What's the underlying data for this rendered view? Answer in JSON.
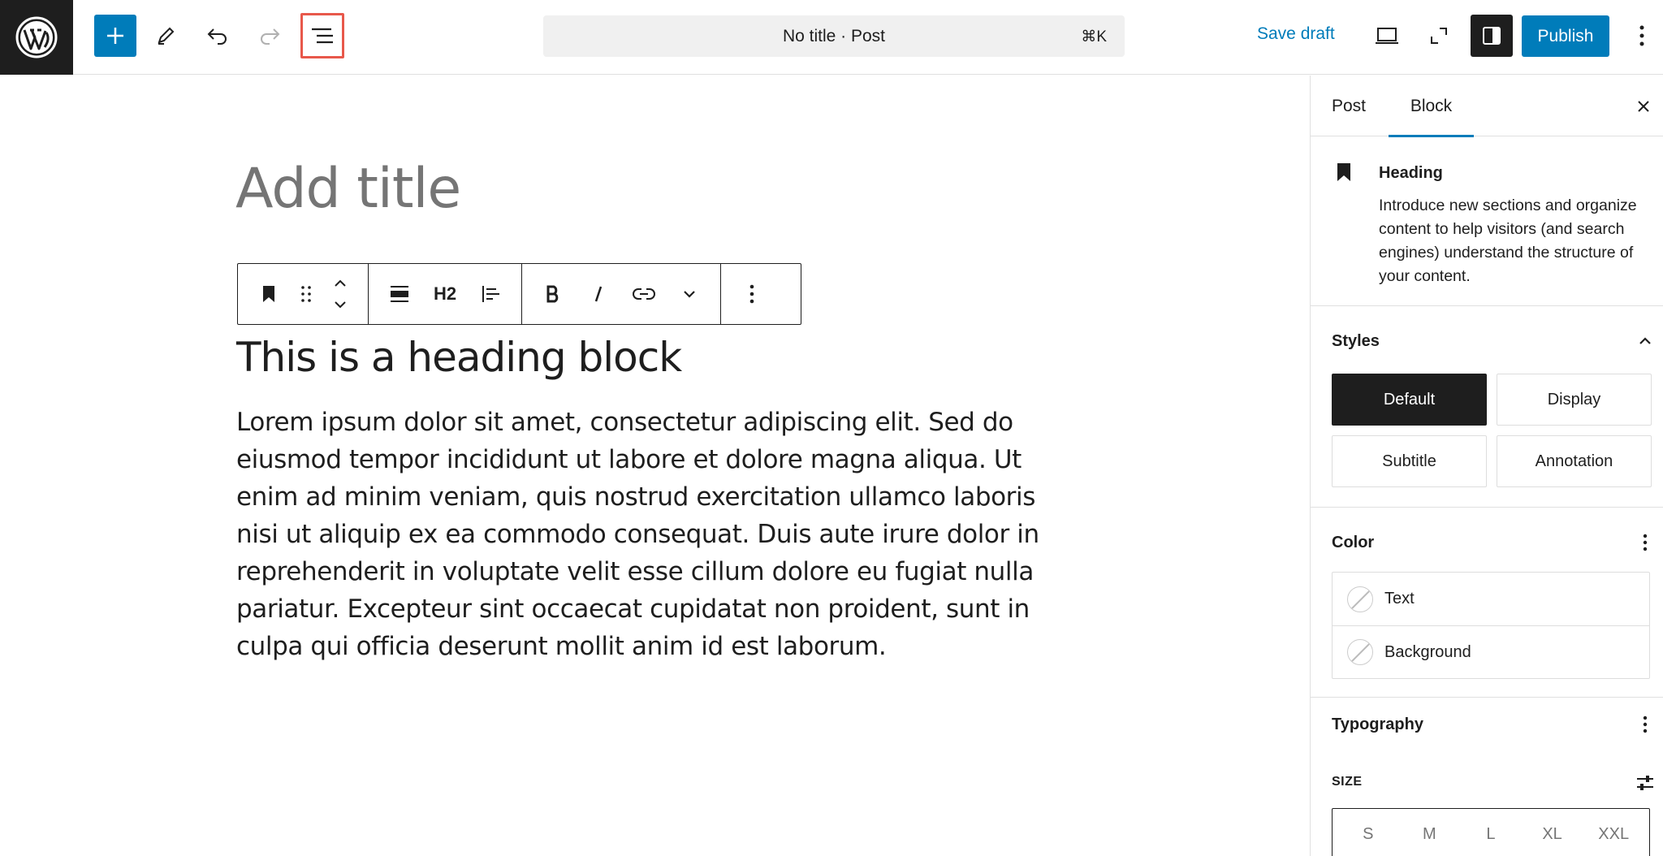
{
  "topbar": {
    "document_title": "No title · Post",
    "command_shortcut": "⌘K",
    "save_draft_label": "Save draft",
    "publish_label": "Publish",
    "icons": [
      "wordpress-logo",
      "plus-icon",
      "pencil-icon",
      "undo-icon",
      "redo-icon",
      "list-view-icon",
      "desktop-preview-icon",
      "fullscreen-icon",
      "sidebar-toggle-icon",
      "more-vertical-icon"
    ]
  },
  "editor": {
    "title_placeholder": "Add title",
    "toolbar": {
      "heading_level_label": "H2"
    },
    "heading_text": "This is a heading block",
    "paragraph_text": "Lorem ipsum dolor sit amet, consectetur adipiscing elit. Sed do eiusmod tempor incididunt ut labore et dolore magna aliqua. Ut enim ad minim veniam, quis nostrud exercitation ullamco laboris nisi ut aliquip ex ea commodo consequat. Duis aute irure dolor in reprehenderit in voluptate velit esse cillum dolore eu fugiat nulla pariatur. Excepteur sint occaecat cupidatat non proident, sunt in culpa qui officia deserunt mollit anim id est laborum."
  },
  "sidebar": {
    "tabs": [
      {
        "label": "Post",
        "active": false
      },
      {
        "label": "Block",
        "active": true
      }
    ],
    "block_card": {
      "name": "Heading",
      "description": "Introduce new sections and organize content to help visitors (and search engines) understand the structure of your content."
    },
    "styles": {
      "title": "Styles",
      "options": [
        {
          "label": "Default",
          "active": true
        },
        {
          "label": "Display",
          "active": false
        },
        {
          "label": "Subtitle",
          "active": false
        },
        {
          "label": "Annotation",
          "active": false
        }
      ]
    },
    "color": {
      "title": "Color",
      "items": [
        {
          "label": "Text"
        },
        {
          "label": "Background"
        }
      ]
    },
    "typography": {
      "title": "Typography",
      "size_label": "SIZE",
      "sizes": [
        "S",
        "M",
        "L",
        "XL",
        "XXL"
      ]
    }
  },
  "colors": {
    "accent": "#007cba",
    "highlight_outline": "#e8584b",
    "dark": "#1e1e1e"
  }
}
